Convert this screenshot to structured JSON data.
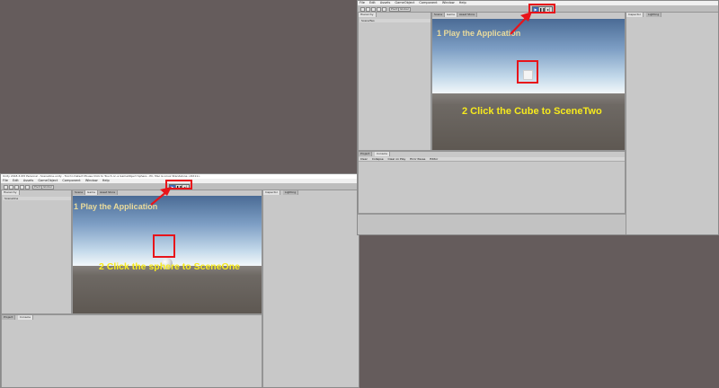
{
  "left_window": {
    "title": "Unity 2018.3.0f2 Personal - SceneOne.unity - Tool to Detect Mouse Click to Touch on a GameObject Sphere - PC, Mac & Linux Standalone <DX11>",
    "menu": [
      "File",
      "Edit",
      "Assets",
      "GameObject",
      "Component",
      "Window",
      "Help"
    ],
    "tabs": {
      "hierarchy": "Hierarchy",
      "scene": "Scene",
      "game": "Game",
      "asset_store": "Asset Store",
      "inspector": "Inspector",
      "lighting": "Lighting",
      "project": "Project",
      "console": "Console"
    },
    "hierarchy_item": "SceneOne",
    "annotation_play": "1 Play the Application",
    "annotation_click": "2 Click the sphere to SceneOne"
  },
  "right_window": {
    "menu": [
      "File",
      "Edit",
      "Assets",
      "GameObject",
      "Component",
      "Window",
      "Help"
    ],
    "tabs": {
      "hierarchy": "Hierarchy",
      "scene": "Scene",
      "game": "Game",
      "asset_store": "Asset Store",
      "inspector": "Inspector",
      "lighting": "Lighting",
      "project": "Project",
      "console": "Console"
    },
    "hierarchy_item": "SceneTwo",
    "console_buttons": [
      "Clear",
      "Collapse",
      "Clear on Play",
      "Error Pause",
      "Editor"
    ],
    "annotation_play": "1 Play the Application",
    "annotation_click": "2 Click the Cube to SceneTwo"
  },
  "toolbar": {
    "pivot_label": "Pivot",
    "global_label": "Global",
    "play_icon": "play-icon",
    "pause_icon": "pause-icon",
    "step_icon": "step-icon"
  },
  "colors": {
    "background": "#655c5c",
    "highlight": "#e8141a",
    "annotation_click": "#f7ea1d",
    "annotation_play": "#eadb9c"
  }
}
